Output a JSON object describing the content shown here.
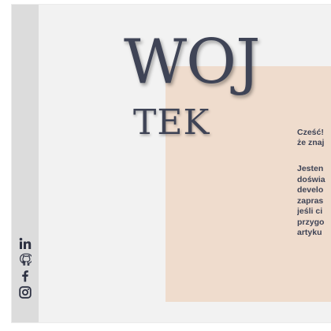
{
  "header": {
    "title_line1": "WOJ",
    "title_line2": "TEK"
  },
  "intro": {
    "greeting_lines": [
      "Cześć!",
      "że znaj"
    ],
    "about_lines": [
      "Jesten",
      "doświa",
      "develo",
      "zapras",
      "jeśli ci",
      "przygo",
      "artyku"
    ]
  },
  "social": [
    {
      "icon": "linkedin-icon",
      "glyph": "in"
    },
    {
      "icon": "github-icon",
      "glyph": "⌘"
    },
    {
      "icon": "facebook-icon",
      "glyph": "f"
    },
    {
      "icon": "instagram-icon",
      "glyph": "◎"
    }
  ],
  "colors": {
    "text": "#3f4456",
    "accent_box": "#efdccd",
    "sidebar": "#dcdcdc",
    "background": "#f2f2f2"
  }
}
